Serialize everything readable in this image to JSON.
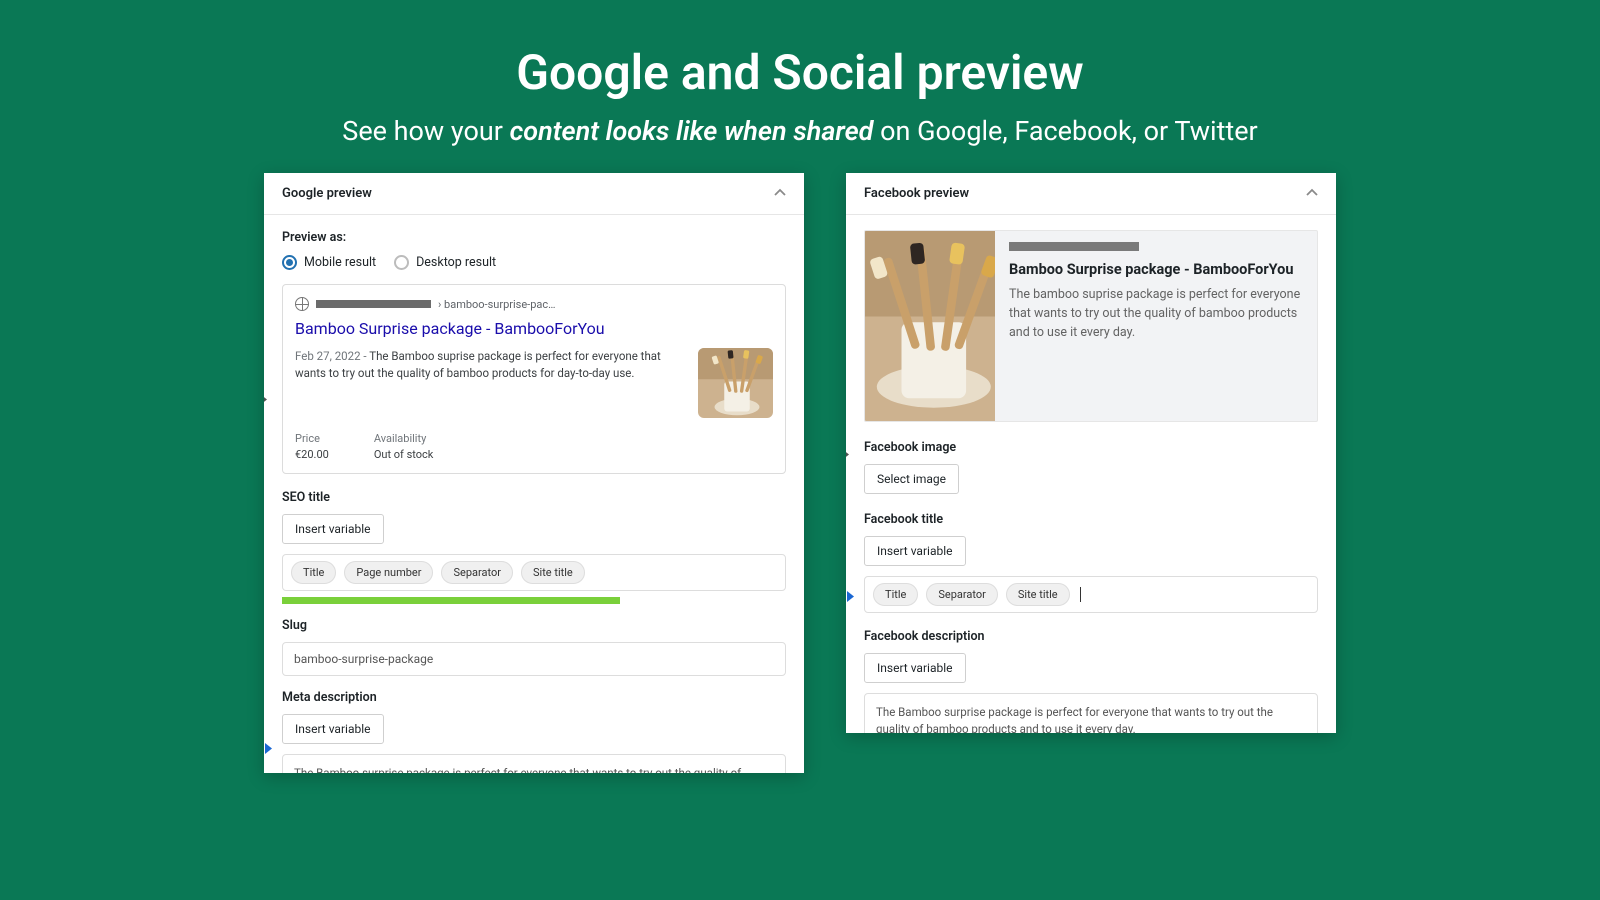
{
  "hero": {
    "title": "Google and Social preview",
    "sub_before": "See how your ",
    "sub_em": "content looks like when shared",
    "sub_after": " on Google, Facebook, or Twitter"
  },
  "google": {
    "header": "Google preview",
    "preview_as": "Preview as:",
    "radio_mobile": "Mobile result",
    "radio_desktop": "Desktop result",
    "breadcrumb": "› bamboo-surprise-pac…",
    "result_title": "Bamboo Surprise package - BambooForYou",
    "result_date": "Feb 27, 2022 - ",
    "result_desc": "The Bamboo suprise package is perfect for everyone that wants to try out the quality of bamboo products for day-to-day use.",
    "price_label": "Price",
    "price_value": "€20.00",
    "avail_label": "Availability",
    "avail_value": "Out of stock",
    "seo_title_lbl": "SEO title",
    "insert_variable": "Insert variable",
    "pill_title": "Title",
    "pill_pagenum": "Page number",
    "pill_sep": "Separator",
    "pill_sitetitle": "Site title",
    "slug_lbl": "Slug",
    "slug_val": "bamboo-surprise-package",
    "meta_lbl": "Meta description",
    "meta_val": "The Bamboo surprise package is perfect for everyone that wants to try out the quality of bamboo products for day-to-day use."
  },
  "facebook": {
    "header": "Facebook preview",
    "title": "Bamboo Surprise package - BambooForYou",
    "desc": "The bamboo suprise package is perfect for everyone that wants to try out the quality of bamboo products and to use it every day.",
    "image_lbl": "Facebook image",
    "select_image": "Select image",
    "title_lbl": "Facebook title",
    "insert_variable": "Insert variable",
    "pill_title": "Title",
    "pill_sep": "Separator",
    "pill_sitetitle": "Site title",
    "desc_lbl": "Facebook description",
    "desc_val": "The Bamboo surprise package is perfect for everyone that wants to try out the quality of bamboo products and to use it every day."
  }
}
